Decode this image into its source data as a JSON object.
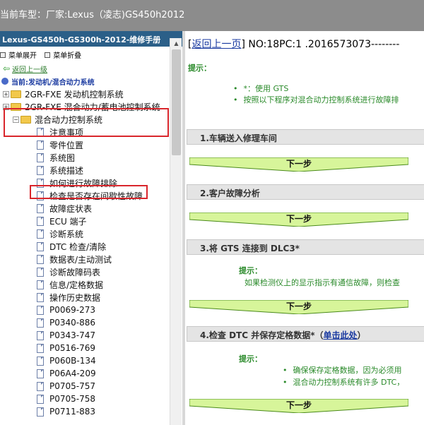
{
  "title_bar": {
    "prefix": "当前车型：",
    "vehicle": "厂家:Lexus（凌志)GS450h2012"
  },
  "left_pane": {
    "header": "Lexus-GS450h-GS300h-2012-维修手册",
    "toolbar": {
      "expand_label": "菜单展开",
      "collapse_label": "菜单折叠"
    },
    "back_link": "返回上一级",
    "current_path": "当前:发动机/混合动力系统",
    "tree": [
      {
        "label": "2GR-FXE 发动机控制系统",
        "type": "folder",
        "expander": "+"
      },
      {
        "label": "2GR-FXE 混合动力/蓄电池控制系统",
        "type": "folder",
        "expander": "+"
      },
      {
        "label": "混合动力控制系统",
        "type": "folder-open",
        "expander": "−"
      },
      {
        "label": "注意事项",
        "type": "doc"
      },
      {
        "label": "零件位置",
        "type": "doc"
      },
      {
        "label": "系统图",
        "type": "doc"
      },
      {
        "label": "系统描述",
        "type": "doc"
      },
      {
        "label": "如何进行故障排除",
        "type": "doc"
      },
      {
        "label": "检查是否存在间歇性故障",
        "type": "doc"
      },
      {
        "label": "故障症状表",
        "type": "doc"
      },
      {
        "label": "ECU 端子",
        "type": "doc"
      },
      {
        "label": "诊断系统",
        "type": "doc"
      },
      {
        "label": "DTC 检查/清除",
        "type": "doc"
      },
      {
        "label": "数据表/主动测试",
        "type": "doc"
      },
      {
        "label": "诊断故障码表",
        "type": "doc"
      },
      {
        "label": "信息/定格数据",
        "type": "doc"
      },
      {
        "label": "操作历史数据",
        "type": "doc"
      },
      {
        "label": "P0069-273",
        "type": "doc"
      },
      {
        "label": "P0340-886",
        "type": "doc"
      },
      {
        "label": "P0343-747",
        "type": "doc"
      },
      {
        "label": "P0516-769",
        "type": "doc"
      },
      {
        "label": "P060B-134",
        "type": "doc"
      },
      {
        "label": "P06A4-209",
        "type": "doc"
      },
      {
        "label": "P0705-757",
        "type": "doc"
      },
      {
        "label": "P0705-758",
        "type": "doc"
      },
      {
        "label": "P0711-883",
        "type": "doc"
      }
    ]
  },
  "right_pane": {
    "back_link": "返回上一页",
    "doc_id": "NO:18PC:1 .2016573073--------",
    "hint_label": "提示：",
    "hint_bullets": [
      "*：使用 GTS",
      "按照以下程序对混合动力控制系统进行故障排"
    ],
    "steps": [
      {
        "title": "1.车辆送入修理车间",
        "next": "下一步"
      },
      {
        "title": "2.客户故障分析",
        "next": "下一步"
      },
      {
        "title": "3.将 GTS 连接到 DLC3*",
        "next": "下一步",
        "hint_title": "提示：",
        "hint_text": "如果检测仪上的显示指示有通信故障，则检查"
      },
      {
        "title": "4.检查 DTC 并保存定格数据*（",
        "link": "单击此处",
        "suffix": "）",
        "next": "下一步",
        "hint_title": "提示：",
        "hint_bullets": [
          "确保保存定格数据，因为必须用",
          "混合动力控制系统有许多 DTC，"
        ]
      }
    ]
  },
  "colors": {
    "title_bar": "#8c8c8c",
    "left_header": "#2b5f88",
    "highlight": "#d9262c",
    "next_button": "#d7f59a",
    "hint_green": "#2a8a2a",
    "link_blue": "#1a3aa0"
  }
}
